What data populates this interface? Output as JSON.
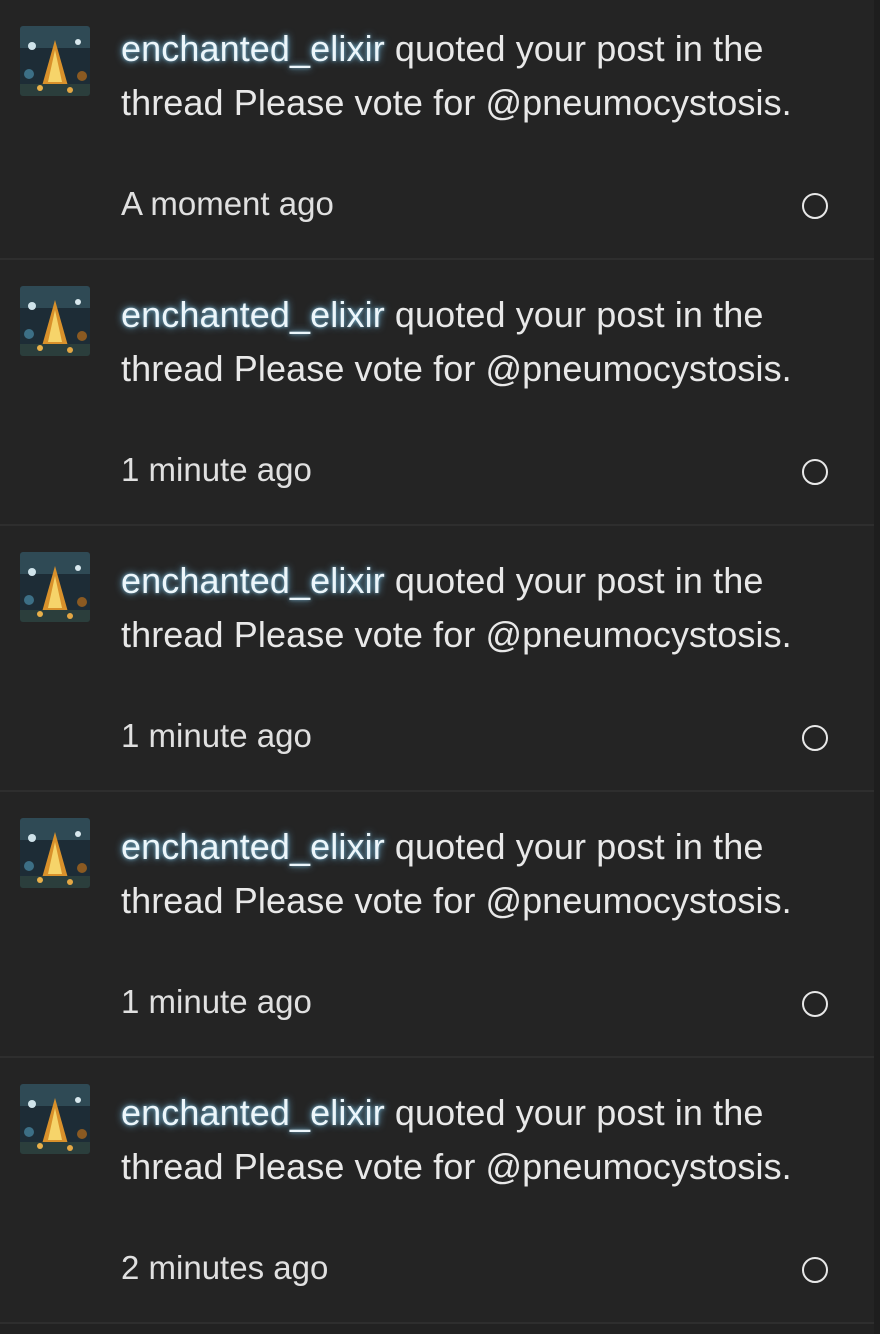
{
  "notifications": [
    {
      "username": "enchanted_elixir",
      "message": " quoted your post in the thread Please vote for @pneumocystosis.",
      "time": "A moment ago"
    },
    {
      "username": "enchanted_elixir",
      "message": " quoted your post in the thread Please vote for @pneumocystosis.",
      "time": "1 minute ago"
    },
    {
      "username": "enchanted_elixir",
      "message": " quoted your post in the thread Please vote for @pneumocystosis.",
      "time": "1 minute ago"
    },
    {
      "username": "enchanted_elixir",
      "message": " quoted your post in the thread Please vote for @pneumocystosis.",
      "time": "1 minute ago"
    },
    {
      "username": "enchanted_elixir",
      "message": " quoted your post in the thread Please vote for @pneumocystosis.",
      "time": "2 minutes ago"
    }
  ],
  "colors": {
    "background": "#222222",
    "row_background": "#242424",
    "divider": "#2e2e2e",
    "text": "#e8e8e8",
    "username_glow": "#78c8f0"
  },
  "icons": {
    "avatar": "user-avatar",
    "status": "unread-circle-icon"
  }
}
